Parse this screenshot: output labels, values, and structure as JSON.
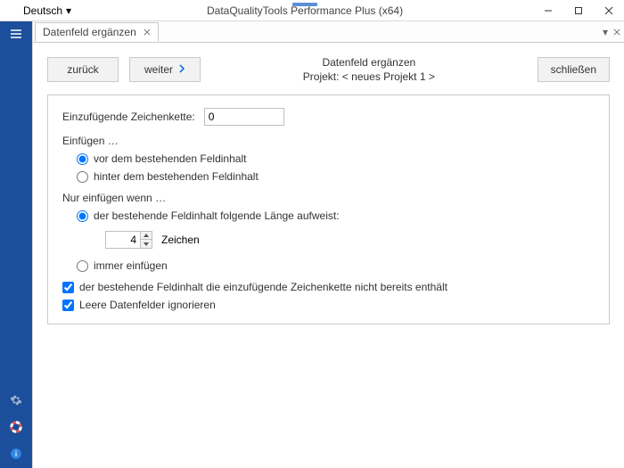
{
  "titlebar": {
    "language": "Deutsch",
    "title": "DataQualityTools Performance Plus (x64)",
    "flag_colors": [
      "#000000",
      "#DD0000",
      "#FFCE00"
    ]
  },
  "tab": {
    "label": "Datenfeld ergänzen"
  },
  "toolbar": {
    "back": "zurück",
    "next": "weiter",
    "close": "schließen",
    "title": "Datenfeld ergänzen",
    "project": "Projekt: < neues Projekt 1 >"
  },
  "form": {
    "insert_string_label": "Einzufügende Zeichenkette:",
    "insert_string_value": "0",
    "insert_head": "Einfügen …",
    "insert_before": "vor dem bestehenden Feldinhalt",
    "insert_after": "hinter dem bestehenden Feldinhalt",
    "only_head": "Nur einfügen wenn …",
    "len_option": "der bestehende Feldinhalt folgende Länge aufweist:",
    "len_value": "4",
    "len_unit": "Zeichen",
    "always": "immer einfügen",
    "not_contains": "der bestehende Feldinhalt die einzufügende Zeichenkette nicht bereits enthält",
    "ignore_empty": "Leere Datenfelder ignorieren"
  }
}
